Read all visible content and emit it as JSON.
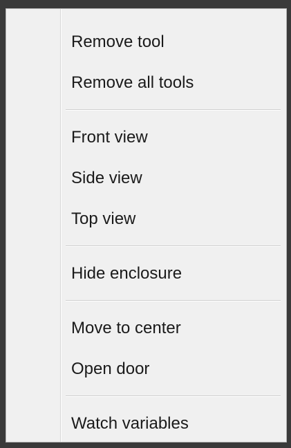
{
  "context_menu": {
    "groups": [
      [
        "Remove tool",
        "Remove all tools"
      ],
      [
        "Front view",
        "Side view",
        "Top view"
      ],
      [
        "Hide enclosure"
      ],
      [
        "Move to center",
        "Open door"
      ],
      [
        "Watch variables"
      ]
    ]
  }
}
